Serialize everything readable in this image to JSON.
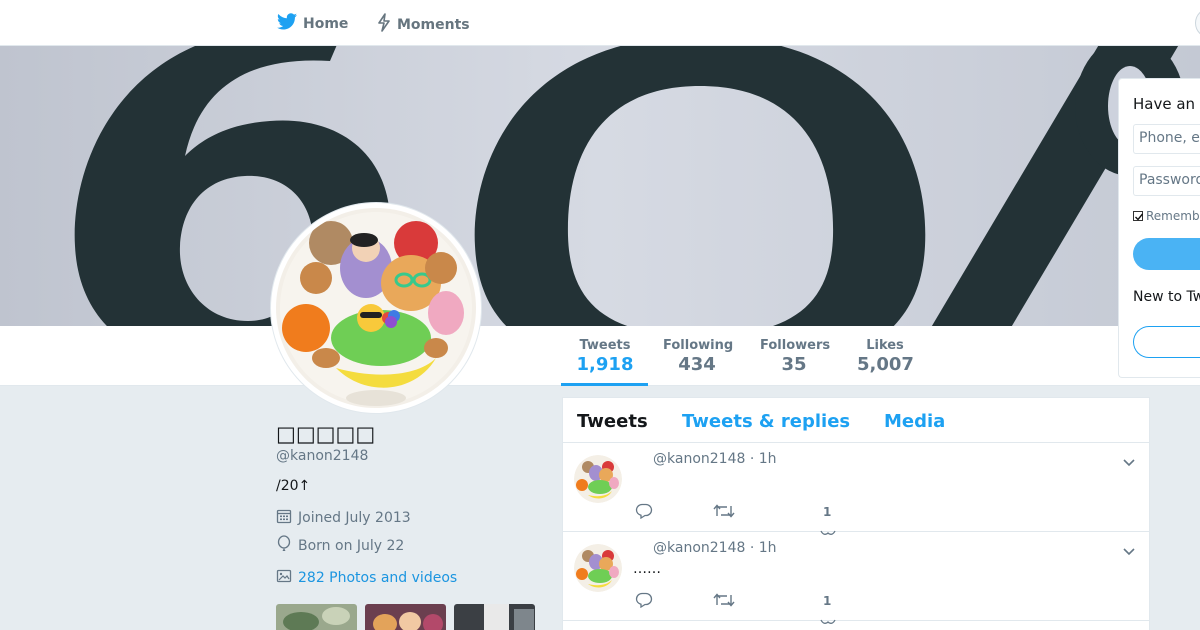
{
  "nav": {
    "home_label": "Home",
    "moments_label": "Moments"
  },
  "profile": {
    "name": "□□□□□",
    "handle": "@kanon2148",
    "bio": "/20↑",
    "joined": "Joined July 2013",
    "born": "Born on July 22",
    "media_link": "282 Photos and videos"
  },
  "stats": {
    "tweets_label": "Tweets",
    "tweets_value": "1,918",
    "following_label": "Following",
    "following_value": "434",
    "followers_label": "Followers",
    "followers_value": "35",
    "likes_label": "Likes",
    "likes_value": "5,007"
  },
  "timeline": {
    "tabs": [
      "Tweets",
      "Tweets & replies",
      "Media"
    ],
    "tweets": [
      {
        "meta": "@kanon2148 · 1h",
        "text": "",
        "likes": "1"
      },
      {
        "meta": "@kanon2148 · 1h",
        "text": "……",
        "likes": "1"
      }
    ]
  },
  "login": {
    "title": "Have an a",
    "phone_placeholder": "Phone, e",
    "password_placeholder": "Password",
    "remember_label": "Rememb",
    "new_to": "New to Tw"
  },
  "colors": {
    "accent": "#1da1f2",
    "background": "#e6ecf0",
    "muted_text": "#657786"
  }
}
